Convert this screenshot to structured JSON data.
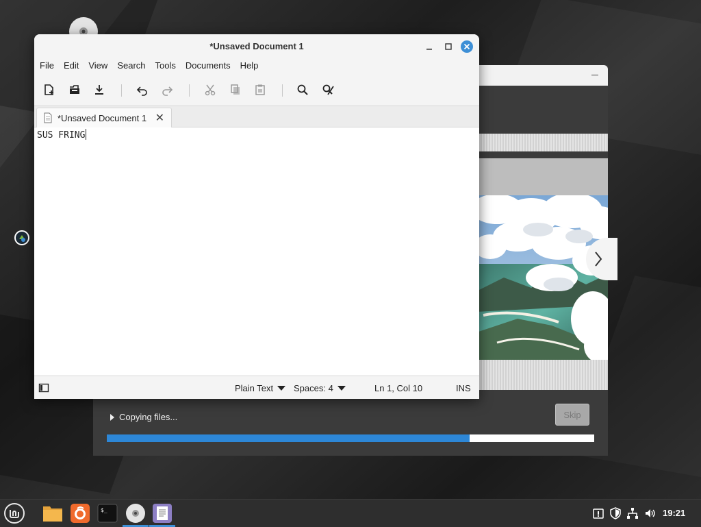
{
  "editor": {
    "window_title": "*Unsaved Document 1",
    "menu": [
      "File",
      "Edit",
      "View",
      "Search",
      "Tools",
      "Documents",
      "Help"
    ],
    "toolbar_icons": [
      "new-document-icon",
      "open-document-icon",
      "save-icon",
      "undo-icon",
      "redo-icon",
      "cut-icon",
      "copy-icon",
      "paste-icon",
      "find-icon",
      "find-replace-icon"
    ],
    "tab_label": "*Unsaved Document 1",
    "content": "SUS FRING",
    "status": {
      "language": "Plain Text",
      "spaces": "Spaces: 4",
      "position": "Ln 1, Col 10",
      "mode": "INS"
    }
  },
  "installer": {
    "status_text": "Copying files...",
    "skip_label": "Skip",
    "progress": 0.745
  },
  "taskbar": {
    "clock": "19:21",
    "apps": [
      "menu-icon",
      "file-manager-icon",
      "firefox-icon",
      "terminal-icon",
      "disc-installer-icon",
      "text-editor-icon"
    ]
  },
  "colors": {
    "accent": "#2d87d7",
    "close_button": "#3d8fd6",
    "taskbar": "#2e2e2e"
  }
}
